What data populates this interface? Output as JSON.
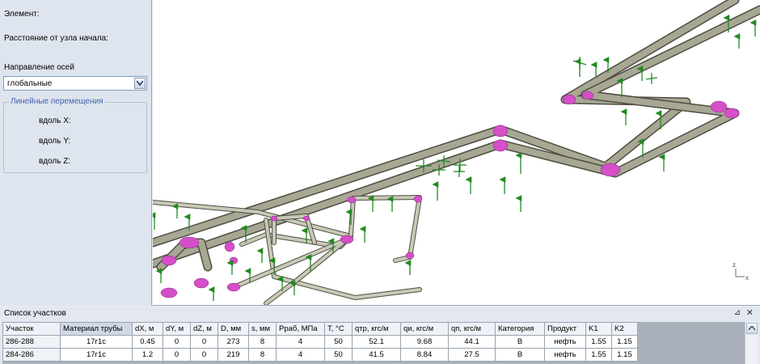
{
  "properties": {
    "element_label": "Элемент:",
    "distance_label": "Расстояние от узла начала:",
    "axes_label": "Направление осей",
    "axes_value": "глобальные",
    "linear_group": "Линейные перемещения",
    "along_x": "вдоль X:",
    "along_y": "вдоль Y:",
    "along_z": "вдоль Z:"
  },
  "viewport": {
    "axis_z": "z",
    "axis_x": "x",
    "colors": {
      "pipe": "#9a9a87",
      "bend": "#d44fc8",
      "support": "#1f8b1f"
    }
  },
  "list": {
    "title": "Список участков",
    "columns": [
      "Участок",
      "Материал трубы",
      "dX, м",
      "dY, м",
      "dZ, м",
      "D, мм",
      "s, мм",
      "Pраб, МПа",
      "T, °C",
      "qтр, кгс/м",
      "qи, кгс/м",
      "qп, кгс/м",
      "Категория",
      "Продукт",
      "K1",
      "K2"
    ],
    "rows": [
      [
        "286-288",
        "17г1с",
        "0.45",
        "0",
        "0",
        "273",
        "8",
        "4",
        "50",
        "52.1",
        "9.68",
        "44.1",
        "В",
        "нефть",
        "1.55",
        "1.15"
      ],
      [
        "284-286",
        "17г1с",
        "1.2",
        "0",
        "0",
        "219",
        "8",
        "4",
        "50",
        "41.5",
        "8.84",
        "27.5",
        "В",
        "нефть",
        "1.55",
        "1.15"
      ]
    ]
  }
}
